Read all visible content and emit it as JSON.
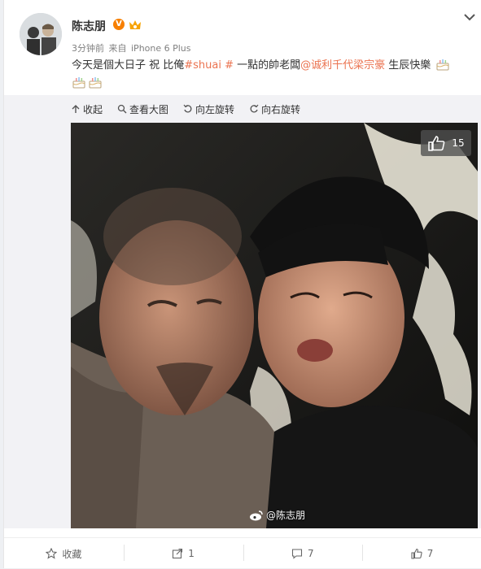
{
  "post": {
    "username": "陈志朋",
    "verified_badge": "V",
    "meta_time": "3分钟前",
    "meta_from": "来自",
    "meta_device": "iPhone 6 Plus",
    "text_part1": "今天是個大日子 祝 比俺",
    "hashtag": "#shuai #",
    "text_part2": " 一點的帥老闆",
    "mention": "@诚利千代梁宗豪",
    "text_part3": " 生辰快樂"
  },
  "toolbar": {
    "collapse": "收起",
    "view_large": "查看大图",
    "rotate_left": "向左旋转",
    "rotate_right": "向右旋转"
  },
  "photo": {
    "like_count": "15",
    "watermark": "@陈志朋"
  },
  "footer": {
    "favorite": "收藏",
    "repost_count": "1",
    "comment_count": "7",
    "like_count": "7"
  },
  "icons": {
    "birthday_cake": "cake-icon",
    "chevron": "chevron-down-icon",
    "weibo_logo": "weibo-icon"
  },
  "colors": {
    "link": "#eb7350",
    "badge": "#f77f00"
  }
}
